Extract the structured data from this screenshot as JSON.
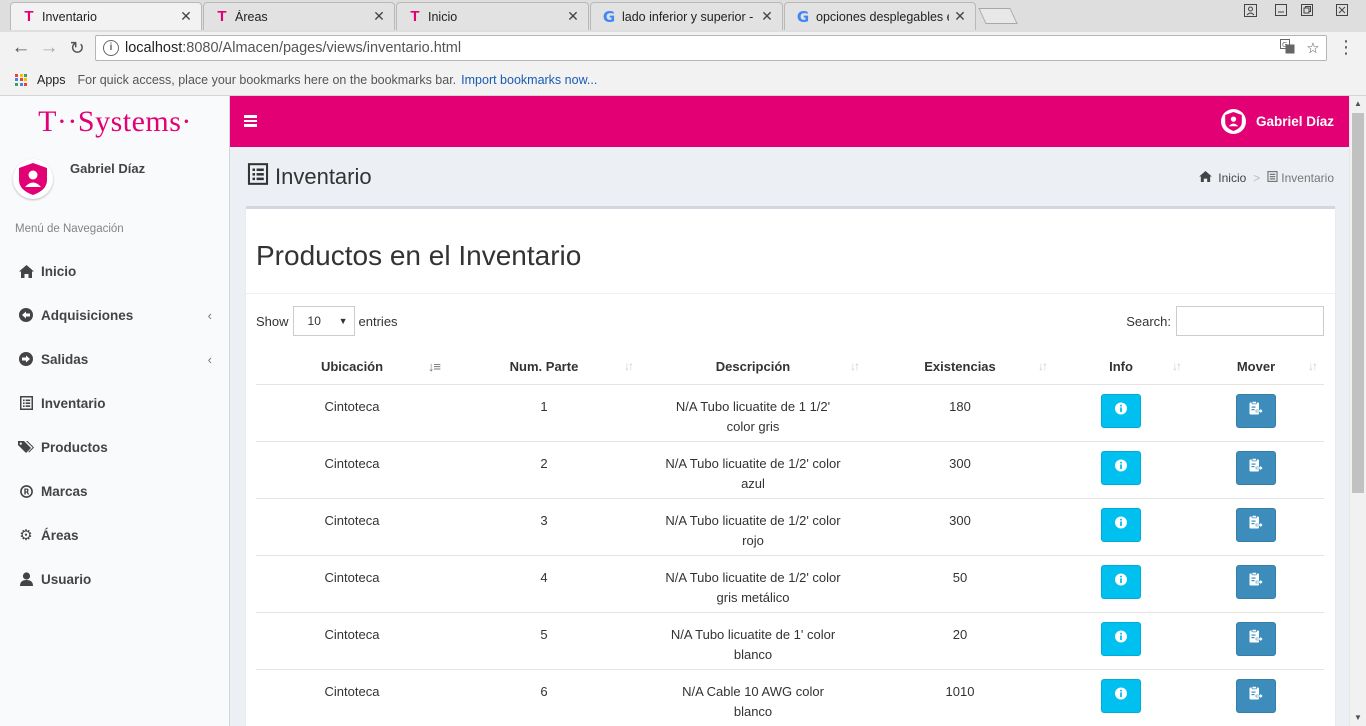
{
  "browser": {
    "tabs": [
      {
        "label": "Inventario",
        "favicon": "t-systems-favicon",
        "active": true
      },
      {
        "label": "Áreas",
        "favicon": "t-systems-favicon",
        "active": false
      },
      {
        "label": "Inicio",
        "favicon": "t-systems-favicon",
        "active": false
      },
      {
        "label": "lado inferior y superior - ",
        "favicon": "google-favicon",
        "active": false
      },
      {
        "label": "opciones desplegables e",
        "favicon": "google-favicon",
        "active": false
      }
    ],
    "url_host": "localhost",
    "url_path": ":8080/Almacen/pages/views/inventario.html",
    "bookmarks": {
      "apps_label": "Apps",
      "hint": "For quick access, place your bookmarks here on the bookmarks bar.",
      "import_link": "Import bookmarks now..."
    }
  },
  "brand": {
    "logo_text": "T··Systems·",
    "accent_color": "#e20074"
  },
  "user": {
    "name": "Gabriel Díaz"
  },
  "sidebar": {
    "header": "Menú de Navegación",
    "items": [
      {
        "label": "Inicio",
        "icon": "home-icon",
        "has_submenu": false
      },
      {
        "label": "Adquisiciones",
        "icon": "arrow-circle-left-icon",
        "has_submenu": true
      },
      {
        "label": "Salidas",
        "icon": "arrow-circle-right-icon",
        "has_submenu": true
      },
      {
        "label": "Inventario",
        "icon": "list-alt-icon",
        "has_submenu": false
      },
      {
        "label": "Productos",
        "icon": "tags-icon",
        "has_submenu": false
      },
      {
        "label": "Marcas",
        "icon": "registered-icon",
        "has_submenu": false
      },
      {
        "label": "Áreas",
        "icon": "gear-icon",
        "has_submenu": false
      },
      {
        "label": "Usuario",
        "icon": "user-icon",
        "has_submenu": false
      }
    ]
  },
  "header": {
    "title": "Inventario",
    "breadcrumb": {
      "home": "Inicio",
      "separator": ">",
      "current": "Inventario"
    }
  },
  "box": {
    "title": "Productos en el Inventario",
    "length": {
      "show": "Show",
      "value": "10",
      "entries": "entries"
    },
    "search": {
      "label": "Search:",
      "value": ""
    }
  },
  "table": {
    "columns": [
      "Ubicación",
      "Num. Parte",
      "Descripción",
      "Existencias",
      "Info",
      "Mover"
    ],
    "sorted_column": 0,
    "rows": [
      {
        "ubicacion": "Cintoteca",
        "num_parte": "1",
        "descripcion": "N/A Tubo licuatite de 1 1/2' color gris",
        "existencias": "180"
      },
      {
        "ubicacion": "Cintoteca",
        "num_parte": "2",
        "descripcion": "N/A Tubo licuatite de 1/2' color azul",
        "existencias": "300"
      },
      {
        "ubicacion": "Cintoteca",
        "num_parte": "3",
        "descripcion": "N/A Tubo licuatite de 1/2' color rojo",
        "existencias": "300"
      },
      {
        "ubicacion": "Cintoteca",
        "num_parte": "4",
        "descripcion": "N/A Tubo licuatite de 1/2' color gris metálico",
        "existencias": "50"
      },
      {
        "ubicacion": "Cintoteca",
        "num_parte": "5",
        "descripcion": "N/A Tubo licuatite de 1' color blanco",
        "existencias": "20"
      },
      {
        "ubicacion": "Cintoteca",
        "num_parte": "6",
        "descripcion": "N/A Cable 10 AWG color blanco",
        "existencias": "1010"
      }
    ],
    "info_button_color": "#00c0ef",
    "move_button_color": "#3c8dbc"
  }
}
